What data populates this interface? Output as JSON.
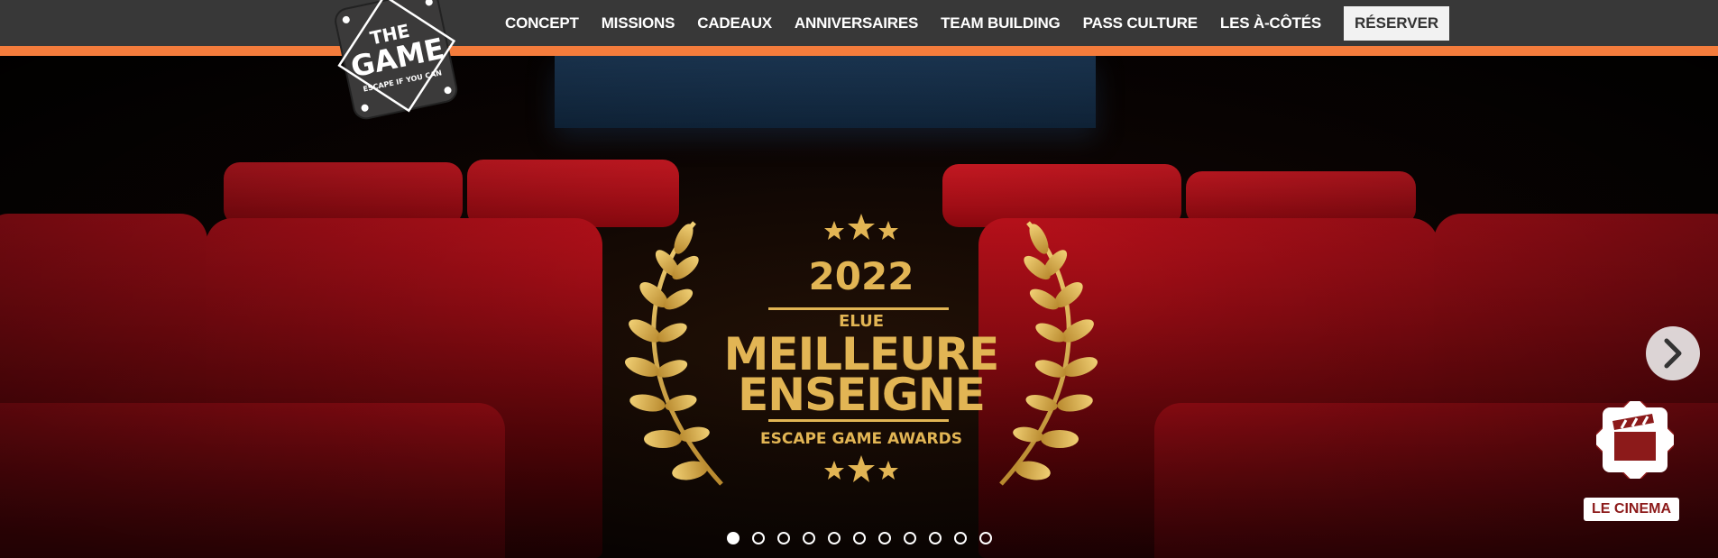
{
  "nav": {
    "items": [
      {
        "label": "CONCEPT"
      },
      {
        "label": "MISSIONS"
      },
      {
        "label": "CADEAUX"
      },
      {
        "label": "ANNIVERSAIRES"
      },
      {
        "label": "TEAM BUILDING"
      },
      {
        "label": "PASS CULTURE"
      },
      {
        "label": "LES À-CÔTÉS"
      }
    ],
    "reserve_label": "RÉSERVER"
  },
  "logo": {
    "line1": "THE",
    "line2": "GAME",
    "tagline": "ESCAPE IF YOU CAN"
  },
  "award": {
    "year": "2022",
    "elue": "ELUE",
    "line1": "MEILLEURE",
    "line2": "ENSEIGNE",
    "subtitle": "ESCAPE GAME AWARDS"
  },
  "mission": {
    "label": "LE CINEMA",
    "icon": "clapperboard-icon"
  },
  "carousel": {
    "slides": 11,
    "active_index": 0,
    "next_icon": "chevron-right-icon"
  },
  "colors": {
    "topbar": "#383838",
    "accent_orange": "#f47c3c",
    "gold": "#e2b554",
    "seat_red": "#b5101a"
  }
}
